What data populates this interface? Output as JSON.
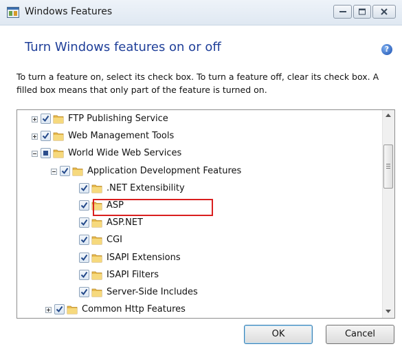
{
  "window": {
    "title": "Windows Features"
  },
  "header": {
    "heading": "Turn Windows features on or off",
    "help_icon": "help-icon",
    "description": "To turn a feature on, select its check box. To turn a feature off, clear its check box. A filled box means that only part of the feature is turned on."
  },
  "tree": {
    "items": [
      {
        "label": "FTP Publishing Service",
        "state": "checked",
        "expander": "plus"
      },
      {
        "label": "Web Management Tools",
        "state": "checked",
        "expander": "plus"
      },
      {
        "label": "World Wide Web Services",
        "state": "partial",
        "expander": "minus"
      },
      {
        "label": "Application Development Features",
        "state": "checked",
        "expander": "minus"
      },
      {
        "label": ".NET Extensibility",
        "state": "checked",
        "expander": "none"
      },
      {
        "label": "ASP",
        "state": "checked",
        "expander": "none",
        "highlighted": true
      },
      {
        "label": "ASP.NET",
        "state": "checked",
        "expander": "none"
      },
      {
        "label": "CGI",
        "state": "checked",
        "expander": "none"
      },
      {
        "label": "ISAPI Extensions",
        "state": "checked",
        "expander": "none"
      },
      {
        "label": "ISAPI Filters",
        "state": "checked",
        "expander": "none"
      },
      {
        "label": "Server-Side Includes",
        "state": "checked",
        "expander": "none"
      },
      {
        "label": "Common Http Features",
        "state": "checked",
        "expander": "plus"
      }
    ]
  },
  "buttons": {
    "ok": "OK",
    "cancel": "Cancel"
  },
  "colors": {
    "heading": "#1f3f99",
    "highlight": "#d91e1e",
    "check": "#2e7d32"
  }
}
